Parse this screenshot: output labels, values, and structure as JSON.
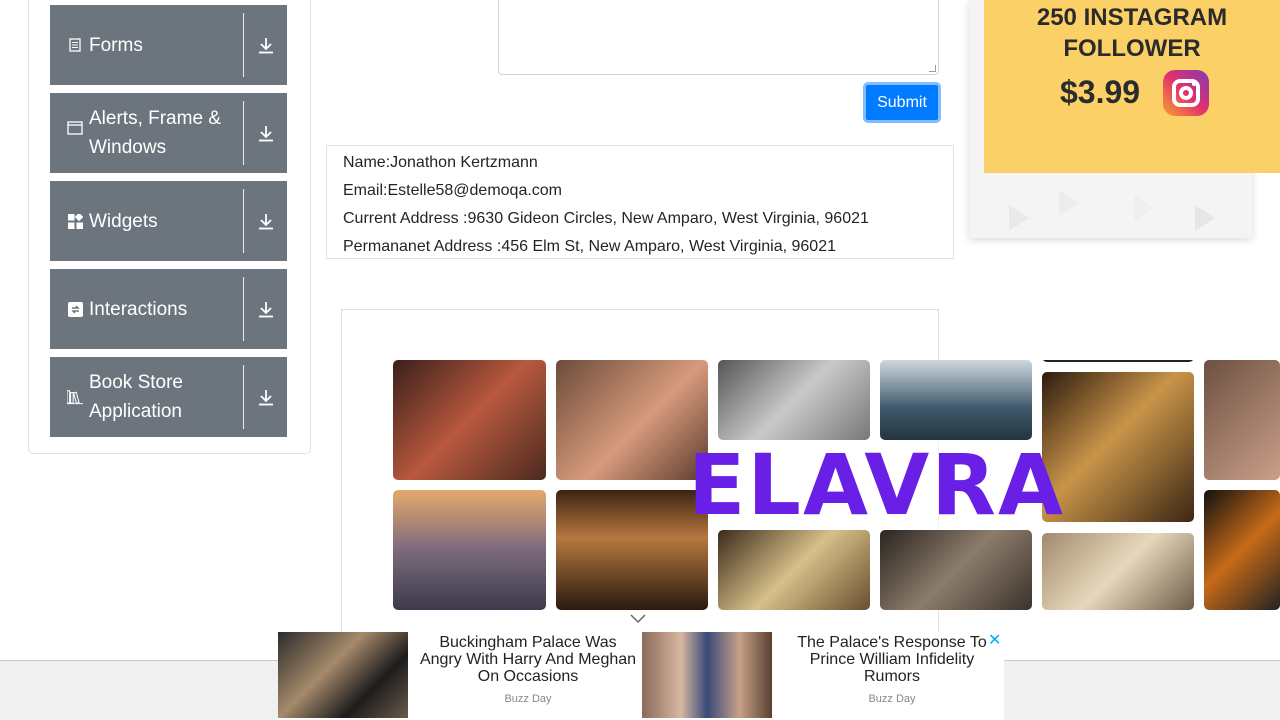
{
  "sidebar": {
    "groups": [
      {
        "label": "Forms",
        "icon": "form-icon"
      },
      {
        "label": "Alerts, Frame & Windows",
        "icon": "window-icon"
      },
      {
        "label": "Widgets",
        "icon": "widgets-icon"
      },
      {
        "label": "Interactions",
        "icon": "interactions-icon"
      },
      {
        "label": "Book Store Application",
        "icon": "bookstore-icon"
      }
    ]
  },
  "form": {
    "submit_label": "Submit"
  },
  "output": {
    "name": "Name:Jonathon Kertzmann",
    "email": "Email:Estelle58@demoqa.com",
    "current_address": "Current Address :9630 Gideon Circles, New Amparo, West Virginia, 96021",
    "permanent_address": "Permananet Address :456 Elm St, New Amparo, West Virginia, 96021"
  },
  "ads": {
    "right": {
      "line1": "250 INSTAGRAM",
      "line2": "FOLLOWER",
      "price": "$3.99"
    },
    "middle": {
      "brand": "ELAVRA"
    },
    "bottom": {
      "stories": [
        {
          "headline": "Buckingham Palace Was Angry With Harry And Meghan On Occasions",
          "source": "Buzz Day"
        },
        {
          "headline": "The Palace's Response To Prince William Infidelity Rumors",
          "source": "Buzz Day"
        }
      ],
      "close_label": "✕"
    }
  },
  "colors": {
    "sidebar_group_bg": "#6c757d",
    "submit_bg": "#007bff",
    "brand_purple": "#6a1fe6",
    "ad_yellow": "#fbd167"
  }
}
